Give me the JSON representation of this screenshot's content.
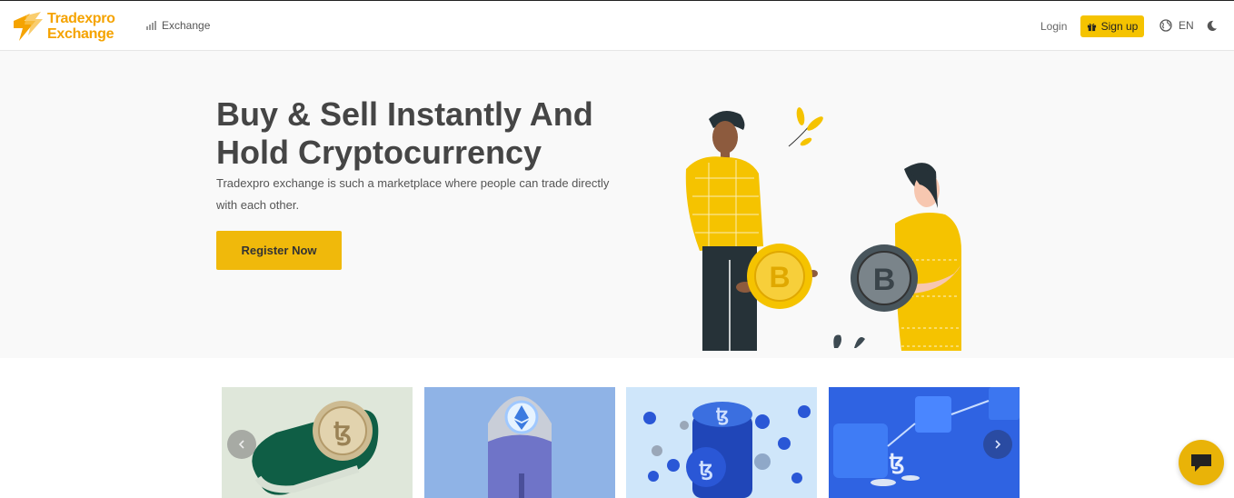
{
  "header": {
    "logo_line1": "Tradexpro",
    "logo_line2": "Exchange",
    "nav_exchange": "Exchange",
    "login": "Login",
    "signup": "Sign up",
    "language": "EN"
  },
  "hero": {
    "title": "Buy & Sell Instantly And Hold Cryptocurrency",
    "description": "Tradexpro exchange is such a marketplace where people can trade directly with each other.",
    "cta": "Register Now"
  },
  "carousel": {
    "cards": [
      {
        "name": "tezos-coin-slot-banner"
      },
      {
        "name": "ethereum-rocket-banner"
      },
      {
        "name": "tezos-coin-stack-banner"
      },
      {
        "name": "tezos-blockchain-cubes-banner"
      }
    ]
  },
  "colors": {
    "brand": "#f5a300",
    "accent": "#f0b90b",
    "signup_bg": "#f5c300",
    "hero_bg": "#f9f9f9"
  },
  "icons": {
    "logo": "bolt-logo-icon",
    "exchange": "bar-chart-icon",
    "signup": "gift-icon",
    "language": "globe-icon",
    "theme": "moon-icon",
    "prev": "chevron-left-icon",
    "next": "chevron-right-icon",
    "chat": "chat-bubble-icon"
  }
}
